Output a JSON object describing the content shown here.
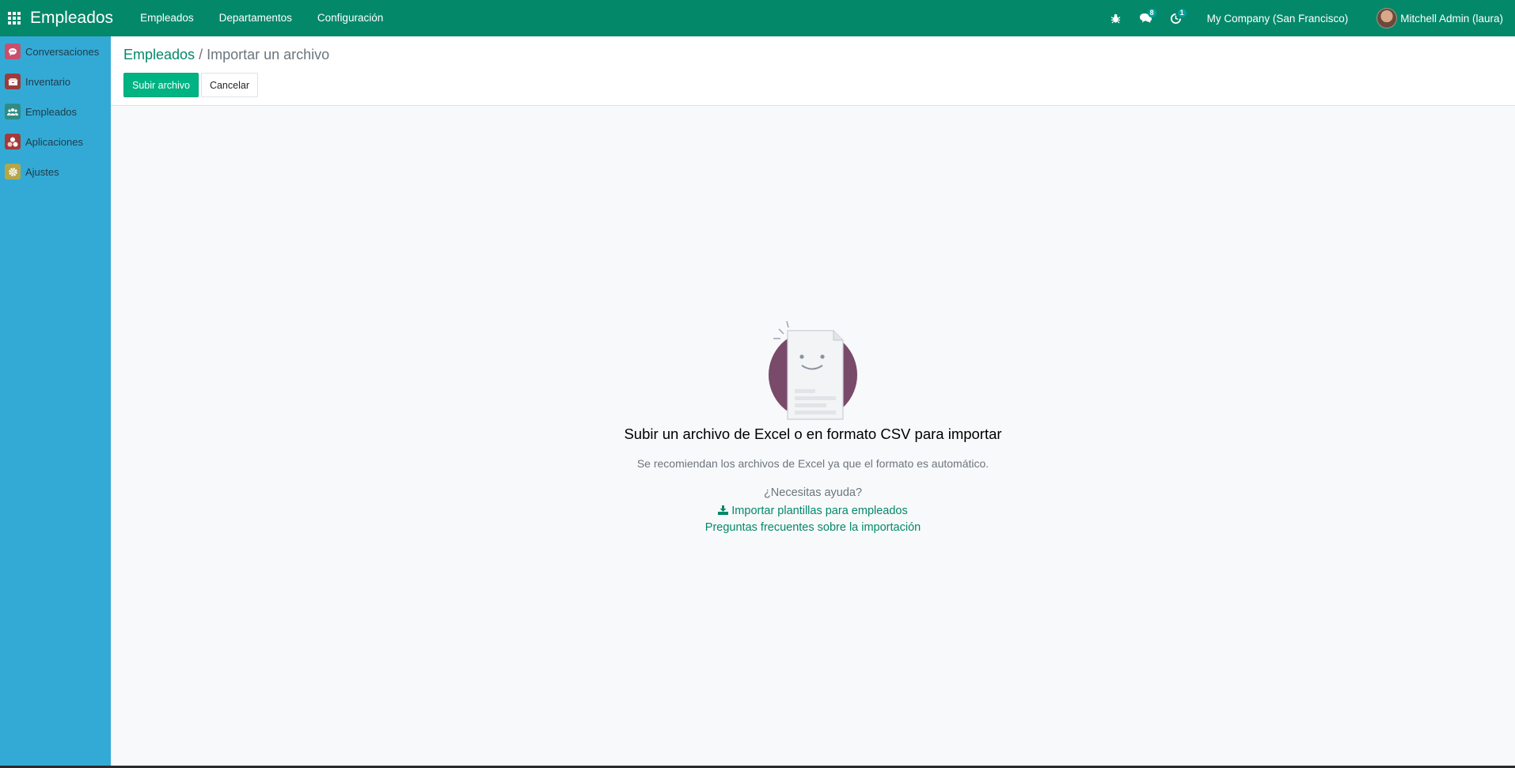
{
  "navbar": {
    "brand": "Empleados",
    "menus": [
      "Empleados",
      "Departamentos",
      "Configuración"
    ],
    "chat_badge": "8",
    "activity_badge": "1",
    "company": "My Company (San Francisco)",
    "user": "Mitchell Admin (laura)",
    "bg_color": "#04886a"
  },
  "sidebar": {
    "bg_color": "#33aad6",
    "items": [
      {
        "label": "Conversaciones",
        "icon": "chat-icon",
        "color": "#c94f6d"
      },
      {
        "label": "Inventario",
        "icon": "inventory-icon",
        "color": "#9b3b3b"
      },
      {
        "label": "Empleados",
        "icon": "employees-icon",
        "color": "#2f8c84"
      },
      {
        "label": "Aplicaciones",
        "icon": "apps-icon",
        "color": "#a23b3b"
      },
      {
        "label": "Ajustes",
        "icon": "settings-icon",
        "color": "#b5a64a"
      }
    ]
  },
  "control_panel": {
    "breadcrumb_parent": "Empleados",
    "breadcrumb_separator": " / ",
    "breadcrumb_current": "Importar un archivo",
    "upload_button": "Subir archivo",
    "cancel_button": "Cancelar"
  },
  "help": {
    "title": "Subir un archivo de Excel o en formato CSV para importar",
    "subtitle": "Se recomiendan los archivos de Excel ya que el formato es automático.",
    "question": "¿Necesitas ayuda?",
    "template_link": "Importar plantillas para empleados",
    "faq_link": "Preguntas frecuentes sobre la importación"
  }
}
